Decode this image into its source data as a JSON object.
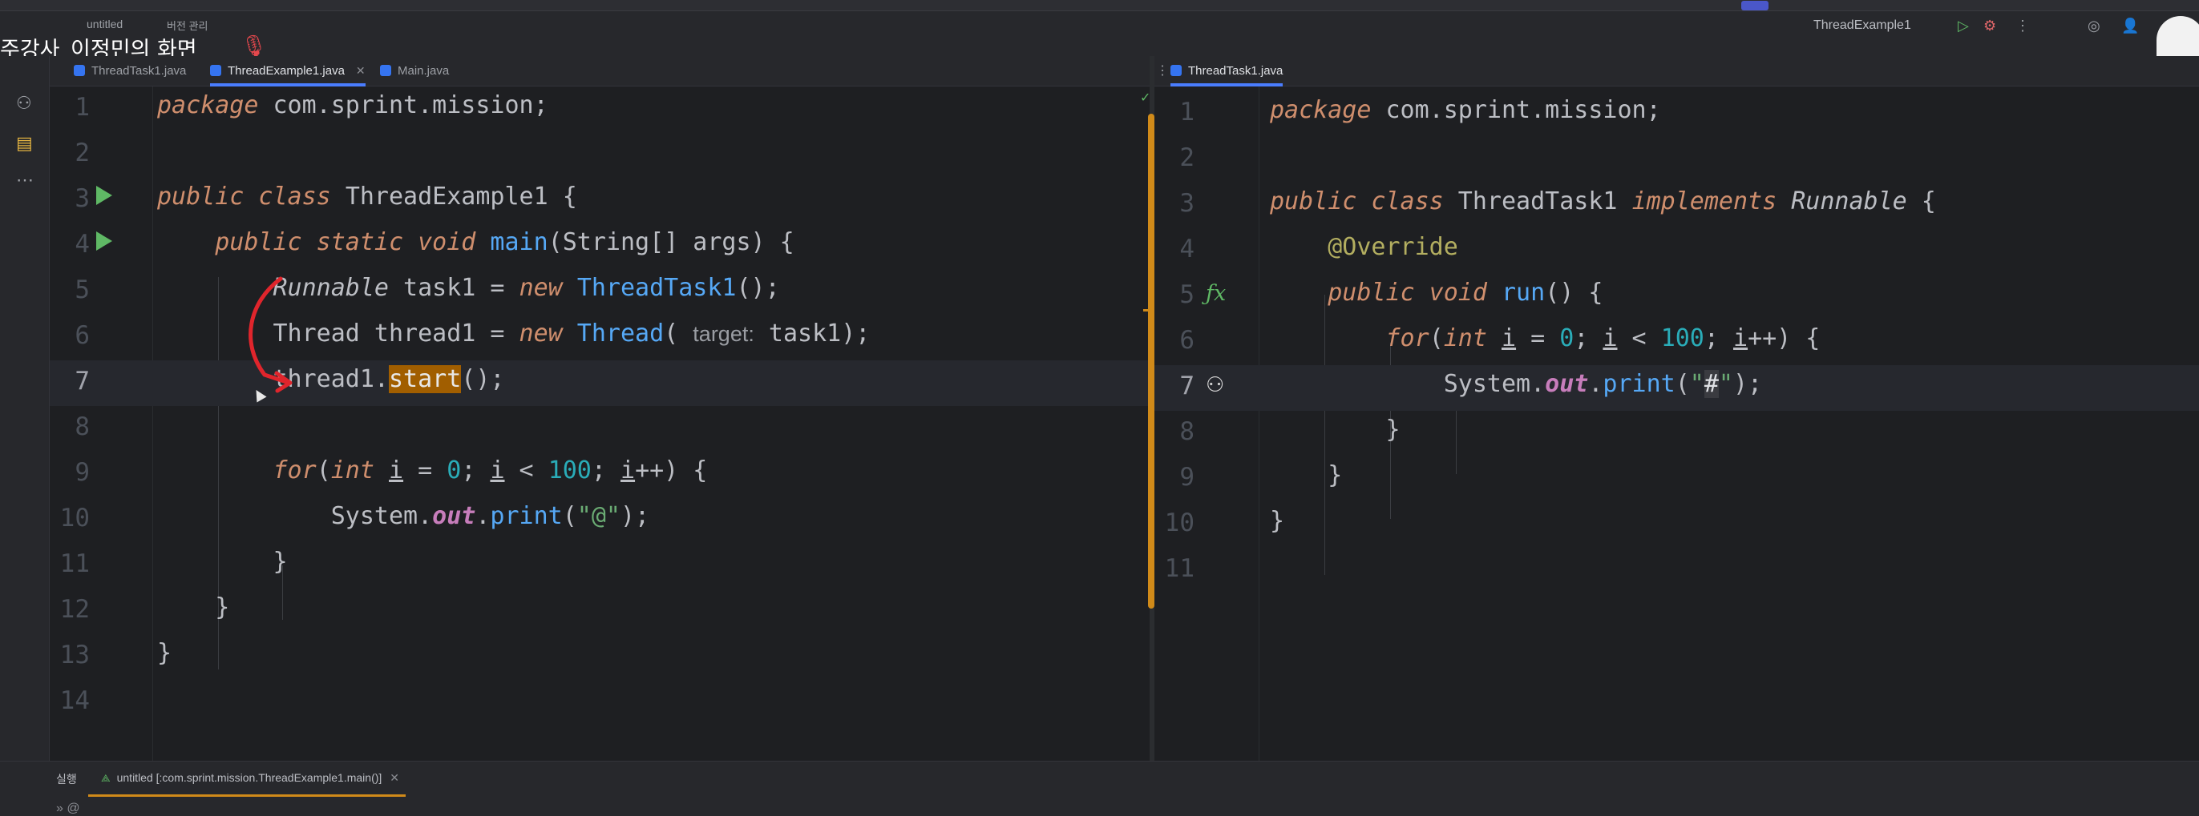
{
  "presenter_label": "주강사_이정민의 화면",
  "toolbar": {
    "project": "untitled",
    "vcs": "버전 관리",
    "run_config": "ThreadExample1"
  },
  "left_tabs": [
    {
      "label": "ThreadTask1.java",
      "active": false
    },
    {
      "label": "ThreadExample1.java",
      "active": true
    },
    {
      "label": "Main.java",
      "active": false
    }
  ],
  "right_tabs": [
    {
      "label": "ThreadTask1.java",
      "active": true
    }
  ],
  "left_editor": {
    "line_numbers": [
      "1",
      "2",
      "3",
      "4",
      "5",
      "6",
      "7",
      "8",
      "9",
      "10",
      "11",
      "12",
      "13",
      "14"
    ],
    "current_line": "7",
    "param_hint": "target:",
    "highlighted_token": "start"
  },
  "right_editor": {
    "line_numbers": [
      "1",
      "2",
      "3",
      "4",
      "5",
      "6",
      "7",
      "8",
      "9",
      "10",
      "11"
    ],
    "current_line": "7"
  },
  "bottom_panel": {
    "section_label": "실행",
    "run_tab_label": "untitled [:com.sprint.mission.ThreadExample1.main()]",
    "console_prefix": "» @"
  },
  "colors": {
    "keyword": "#cf8e6d",
    "class_name": "#6aab73",
    "method": "#56a8f5",
    "number": "#2aacb8",
    "static_field": "#c77dbb",
    "highlight": "#a15e00",
    "scroll_marker": "#d08a19",
    "annotation_arrow": "#e0252c"
  },
  "icons": [
    "run-gutter-icon",
    "override-gutter-icon",
    "breakpoint-gutter-icon",
    "mic-off-icon",
    "close-icon",
    "kebab-icon",
    "checkmark-icon"
  ]
}
